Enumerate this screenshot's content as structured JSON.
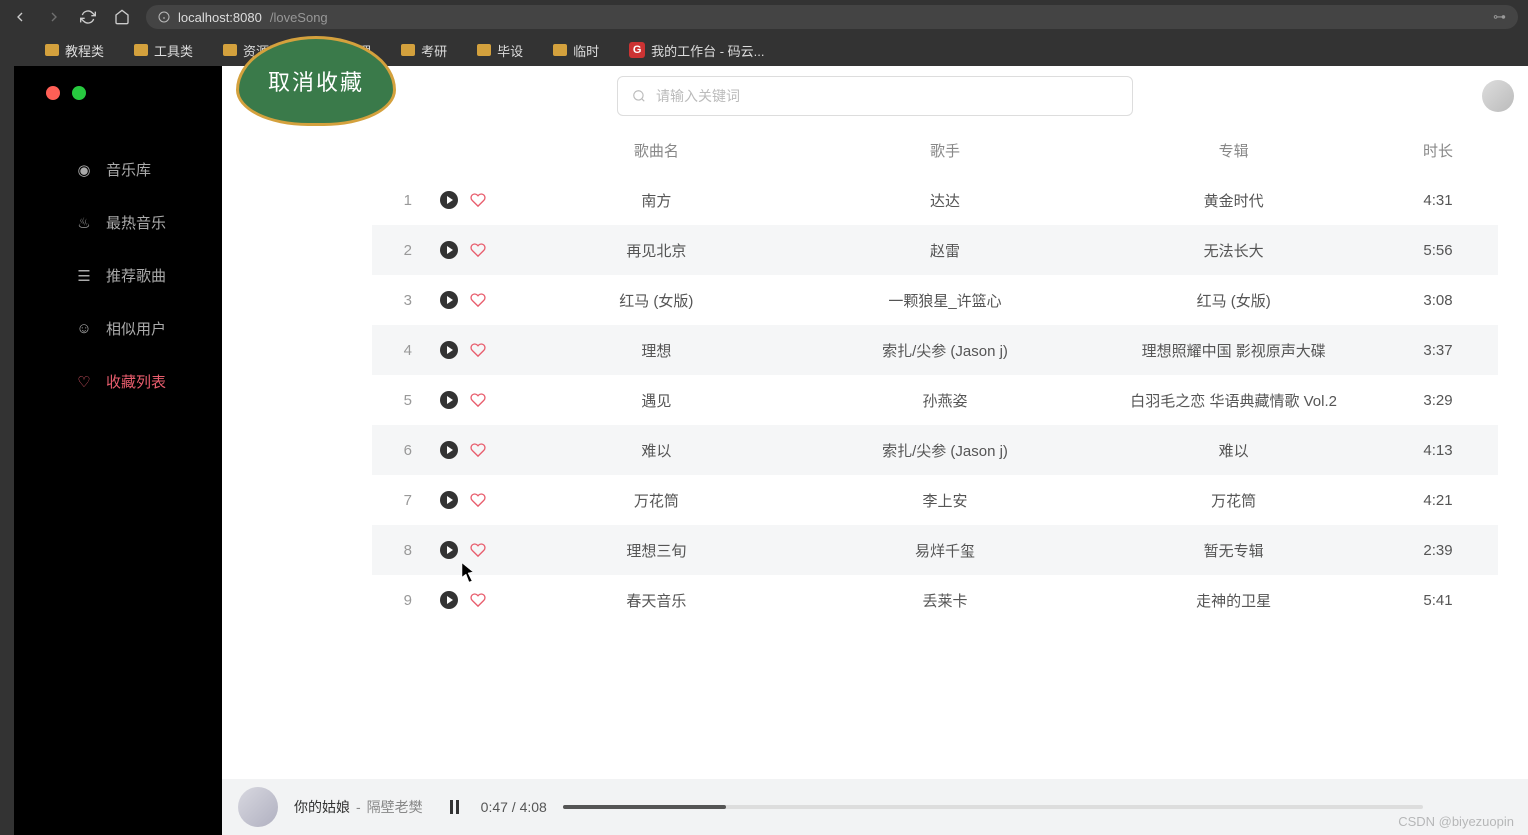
{
  "browser": {
    "url_host": "localhost:8080",
    "url_path": "/loveSong",
    "bookmarks": [
      {
        "label": "教程类",
        "type": "folder"
      },
      {
        "label": "工具类",
        "type": "folder"
      },
      {
        "label": "资源网站",
        "type": "folder"
      },
      {
        "label": "武理",
        "type": "folder"
      },
      {
        "label": "考研",
        "type": "folder"
      },
      {
        "label": "毕设",
        "type": "folder"
      },
      {
        "label": "临时",
        "type": "folder"
      },
      {
        "label": "我的工作台 - 码云...",
        "type": "gitee"
      }
    ]
  },
  "badge": {
    "text": "取消收藏"
  },
  "search": {
    "placeholder": "请输入关键词"
  },
  "sidebar": {
    "items": [
      {
        "icon": "music-library",
        "label": "音乐库"
      },
      {
        "icon": "fire",
        "label": "最热音乐"
      },
      {
        "icon": "list",
        "label": "推荐歌曲"
      },
      {
        "icon": "user",
        "label": "相似用户"
      },
      {
        "icon": "heart",
        "label": "收藏列表"
      }
    ],
    "active_index": 4
  },
  "table": {
    "headers": {
      "song": "歌曲名",
      "artist": "歌手",
      "album": "专辑",
      "duration": "时长"
    },
    "rows": [
      {
        "idx": "1",
        "song": "南方",
        "artist": "达达",
        "album": "黄金时代",
        "duration": "4:31"
      },
      {
        "idx": "2",
        "song": "再见北京",
        "artist": "赵雷",
        "album": "无法长大",
        "duration": "5:56"
      },
      {
        "idx": "3",
        "song": "红马 (女版)",
        "artist": "一颗狼星_许篮心",
        "album": "红马 (女版)",
        "duration": "3:08"
      },
      {
        "idx": "4",
        "song": "理想",
        "artist": "索扎/尖参   (Jason j)",
        "album": "理想照耀中国 影视原声大碟",
        "duration": "3:37"
      },
      {
        "idx": "5",
        "song": "遇见",
        "artist": "孙燕姿",
        "album": "白羽毛之恋 华语典藏情歌 Vol.2",
        "duration": "3:29"
      },
      {
        "idx": "6",
        "song": "难以",
        "artist": "索扎/尖参   (Jason j)",
        "album": "难以",
        "duration": "4:13"
      },
      {
        "idx": "7",
        "song": "万花筒",
        "artist": "李上安",
        "album": "万花筒",
        "duration": "4:21"
      },
      {
        "idx": "8",
        "song": "理想三旬",
        "artist": "易烊千玺",
        "album": "暂无专辑",
        "duration": "2:39"
      },
      {
        "idx": "9",
        "song": "春天音乐",
        "artist": "丢莱卡",
        "album": "走神的卫星",
        "duration": "5:41"
      }
    ]
  },
  "player": {
    "title": "你的姑娘",
    "artist_prefix": " - ",
    "artist": "隔壁老樊",
    "current": "0:47",
    "total": "4:08",
    "progress_pct": 19
  },
  "watermark": "CSDN @biyezuopin"
}
